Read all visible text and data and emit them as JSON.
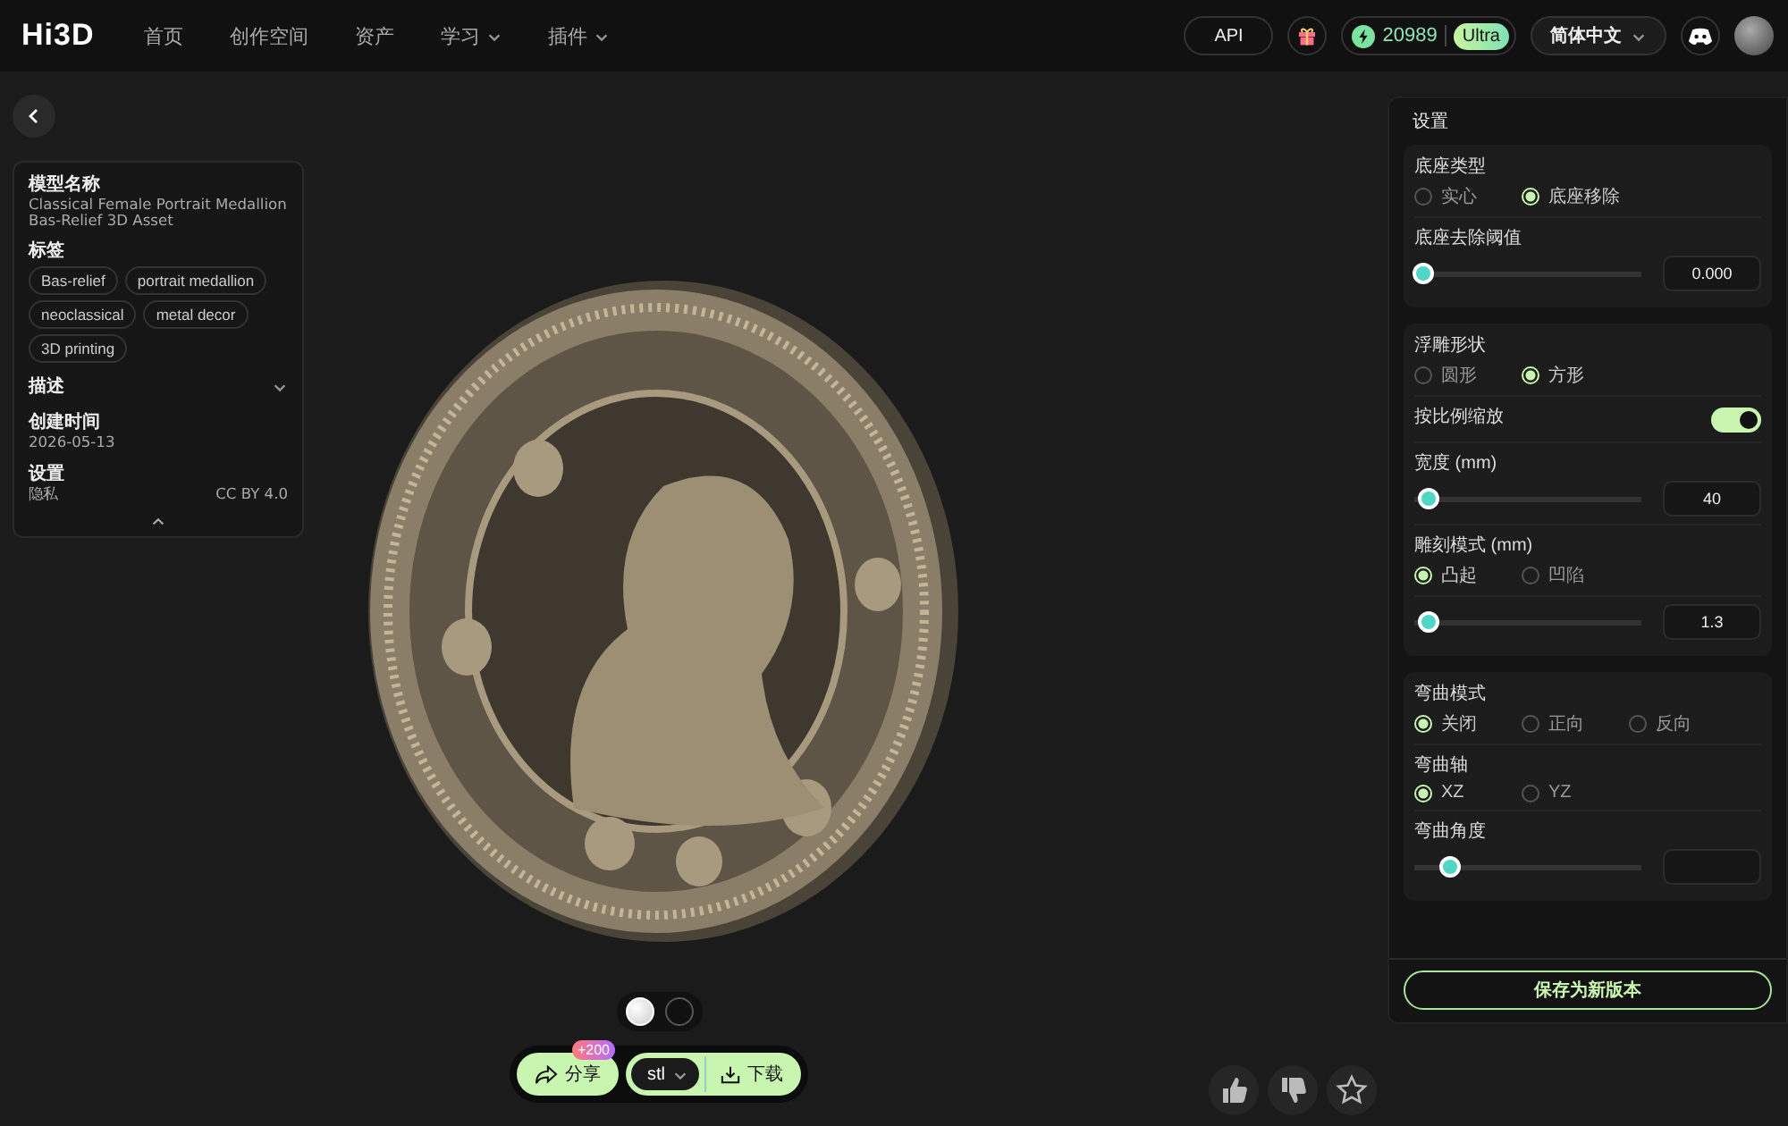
{
  "header": {
    "logo": "Hi3D",
    "nav": [
      {
        "label": "首页",
        "dropdown": false
      },
      {
        "label": "创作空间",
        "dropdown": false
      },
      {
        "label": "资产",
        "dropdown": false
      },
      {
        "label": "学习",
        "dropdown": true
      },
      {
        "label": "插件",
        "dropdown": true
      }
    ],
    "api": "API",
    "credits": "20989",
    "tier": "Ultra",
    "language": "简体中文"
  },
  "info": {
    "fields": [
      {
        "kind": "text",
        "label": "模型名称",
        "value": "Classical Female Portrait Medallion Bas-Relief 3D Asset"
      },
      {
        "kind": "tags",
        "label": "标签",
        "tags": [
          "Bas-relief",
          "portrait medallion",
          "neoclassical",
          "metal decor",
          "3D printing"
        ]
      },
      {
        "kind": "collapsible",
        "label": "描述",
        "expanded": false
      },
      {
        "kind": "text",
        "label": "创建时间",
        "value": "2026-05-13"
      },
      {
        "kind": "pair",
        "label": "设置",
        "value": "隐私",
        "extra": "CC BY 4.0"
      }
    ]
  },
  "viewer": {
    "swatches": [
      {
        "kind": "light",
        "selected": true
      },
      {
        "kind": "dark",
        "selected": false
      }
    ],
    "share": "分享",
    "share_badge": "+200",
    "format": "stl",
    "download": "下载"
  },
  "settings": {
    "title": "设置",
    "groups": [
      {
        "rows": [
          {
            "kind": "radio",
            "label": "底座类型",
            "options": [
              {
                "label": "实心",
                "selected": false
              },
              {
                "label": "底座移除",
                "selected": true
              }
            ]
          },
          {
            "kind": "slider",
            "label": "底座去除阈值",
            "level": 0,
            "value": "0.000"
          }
        ]
      },
      {
        "rows": [
          {
            "kind": "radio",
            "label": "浮雕形状",
            "options": [
              {
                "label": "圆形",
                "selected": false
              },
              {
                "label": "方形",
                "selected": true
              }
            ]
          },
          {
            "kind": "toggle",
            "label": "按比例缩放",
            "on": true
          },
          {
            "kind": "slider",
            "label": "宽度 (mm)",
            "level": 0.02,
            "value": "40"
          },
          {
            "kind": "radio",
            "label": "雕刻模式 (mm)",
            "options": [
              {
                "label": "凸起",
                "selected": true
              },
              {
                "label": "凹陷",
                "selected": false
              }
            ]
          },
          {
            "kind": "slider",
            "level": 0.02,
            "value": "1.3"
          }
        ]
      },
      {
        "rows": [
          {
            "kind": "radio",
            "label": "弯曲模式",
            "options": [
              {
                "label": "关闭",
                "selected": true
              },
              {
                "label": "正向",
                "selected": false
              },
              {
                "label": "反向",
                "selected": false
              }
            ]
          },
          {
            "kind": "radio",
            "label": "弯曲轴",
            "options": [
              {
                "label": "XZ",
                "selected": true
              },
              {
                "label": "YZ",
                "selected": false
              }
            ]
          },
          {
            "kind": "slider",
            "label": "弯曲角度",
            "level": 0.12
          }
        ]
      }
    ],
    "save": "保存为新版本"
  }
}
